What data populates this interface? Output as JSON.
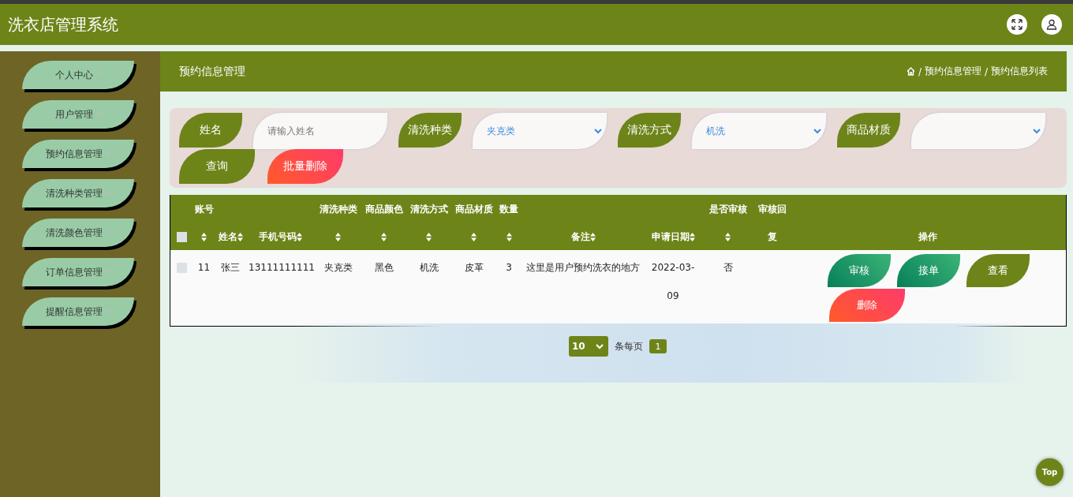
{
  "header": {
    "title": "洗衣店管理系统"
  },
  "sidebar": {
    "items": [
      {
        "label": "个人中心"
      },
      {
        "label": "用户管理"
      },
      {
        "label": "预约信息管理"
      },
      {
        "label": "清洗种类管理"
      },
      {
        "label": "清洗颜色管理"
      },
      {
        "label": "订单信息管理"
      },
      {
        "label": "提醒信息管理"
      }
    ]
  },
  "page_title": "预约信息管理",
  "breadcrumb": [
    {
      "separator": "/",
      "label": "预约信息管理"
    },
    {
      "separator": "/",
      "label": "预约信息列表"
    }
  ],
  "search": {
    "fields": [
      {
        "label": "姓名",
        "kind": "input",
        "placeholder": "请输入姓名"
      },
      {
        "label": "清洗种类",
        "kind": "select",
        "value": "夹克类"
      },
      {
        "label": "清洗方式",
        "kind": "select",
        "value": "机洗"
      },
      {
        "label": "商品材质",
        "kind": "select"
      }
    ],
    "buttons": [
      {
        "label": "查询",
        "kind": "primary"
      },
      {
        "label": "批量删除",
        "kind": "danger"
      }
    ]
  },
  "table": {
    "select_all_checked": false,
    "columns": [
      {
        "top": "账号",
        "sortable": true
      },
      {
        "bottom": "姓名",
        "sortable": true
      },
      {
        "bottom": "手机号码",
        "sortable": true
      },
      {
        "top": "清洗种类",
        "sortable": true
      },
      {
        "top": "商品颜色",
        "sortable": true
      },
      {
        "top": "清洗方式",
        "sortable": true
      },
      {
        "top": "商品材质",
        "sortable": true
      },
      {
        "top": "数量",
        "sortable": true
      },
      {
        "bottom": "备注",
        "sortable": true
      },
      {
        "bottom": "申请日期",
        "sortable": true
      },
      {
        "top": "是否审核",
        "sortable": true
      },
      {
        "top": "审核回",
        "bottom": "复",
        "sortable": false
      },
      {
        "bottom": "操作",
        "sortable": false
      }
    ],
    "rows": [
      {
        "checked": false,
        "cells": [
          "11",
          "张三",
          "13111111111",
          "夹克类",
          "黑色",
          "机洗",
          "皮革",
          "3",
          "这里是用户预约洗衣的地方",
          "2022-03-09",
          "否"
        ],
        "actions": [
          {
            "label": "审核",
            "kind": "success"
          },
          {
            "label": "接单",
            "kind": "success"
          },
          {
            "label": "查看",
            "kind": "primary"
          },
          {
            "label": "删除",
            "kind": "danger"
          }
        ]
      }
    ]
  },
  "pagination": {
    "page_size": "10",
    "page_size_label": "条每页",
    "pages": [
      {
        "label": "1",
        "selected": true
      }
    ]
  },
  "back_to_top": "Top"
}
